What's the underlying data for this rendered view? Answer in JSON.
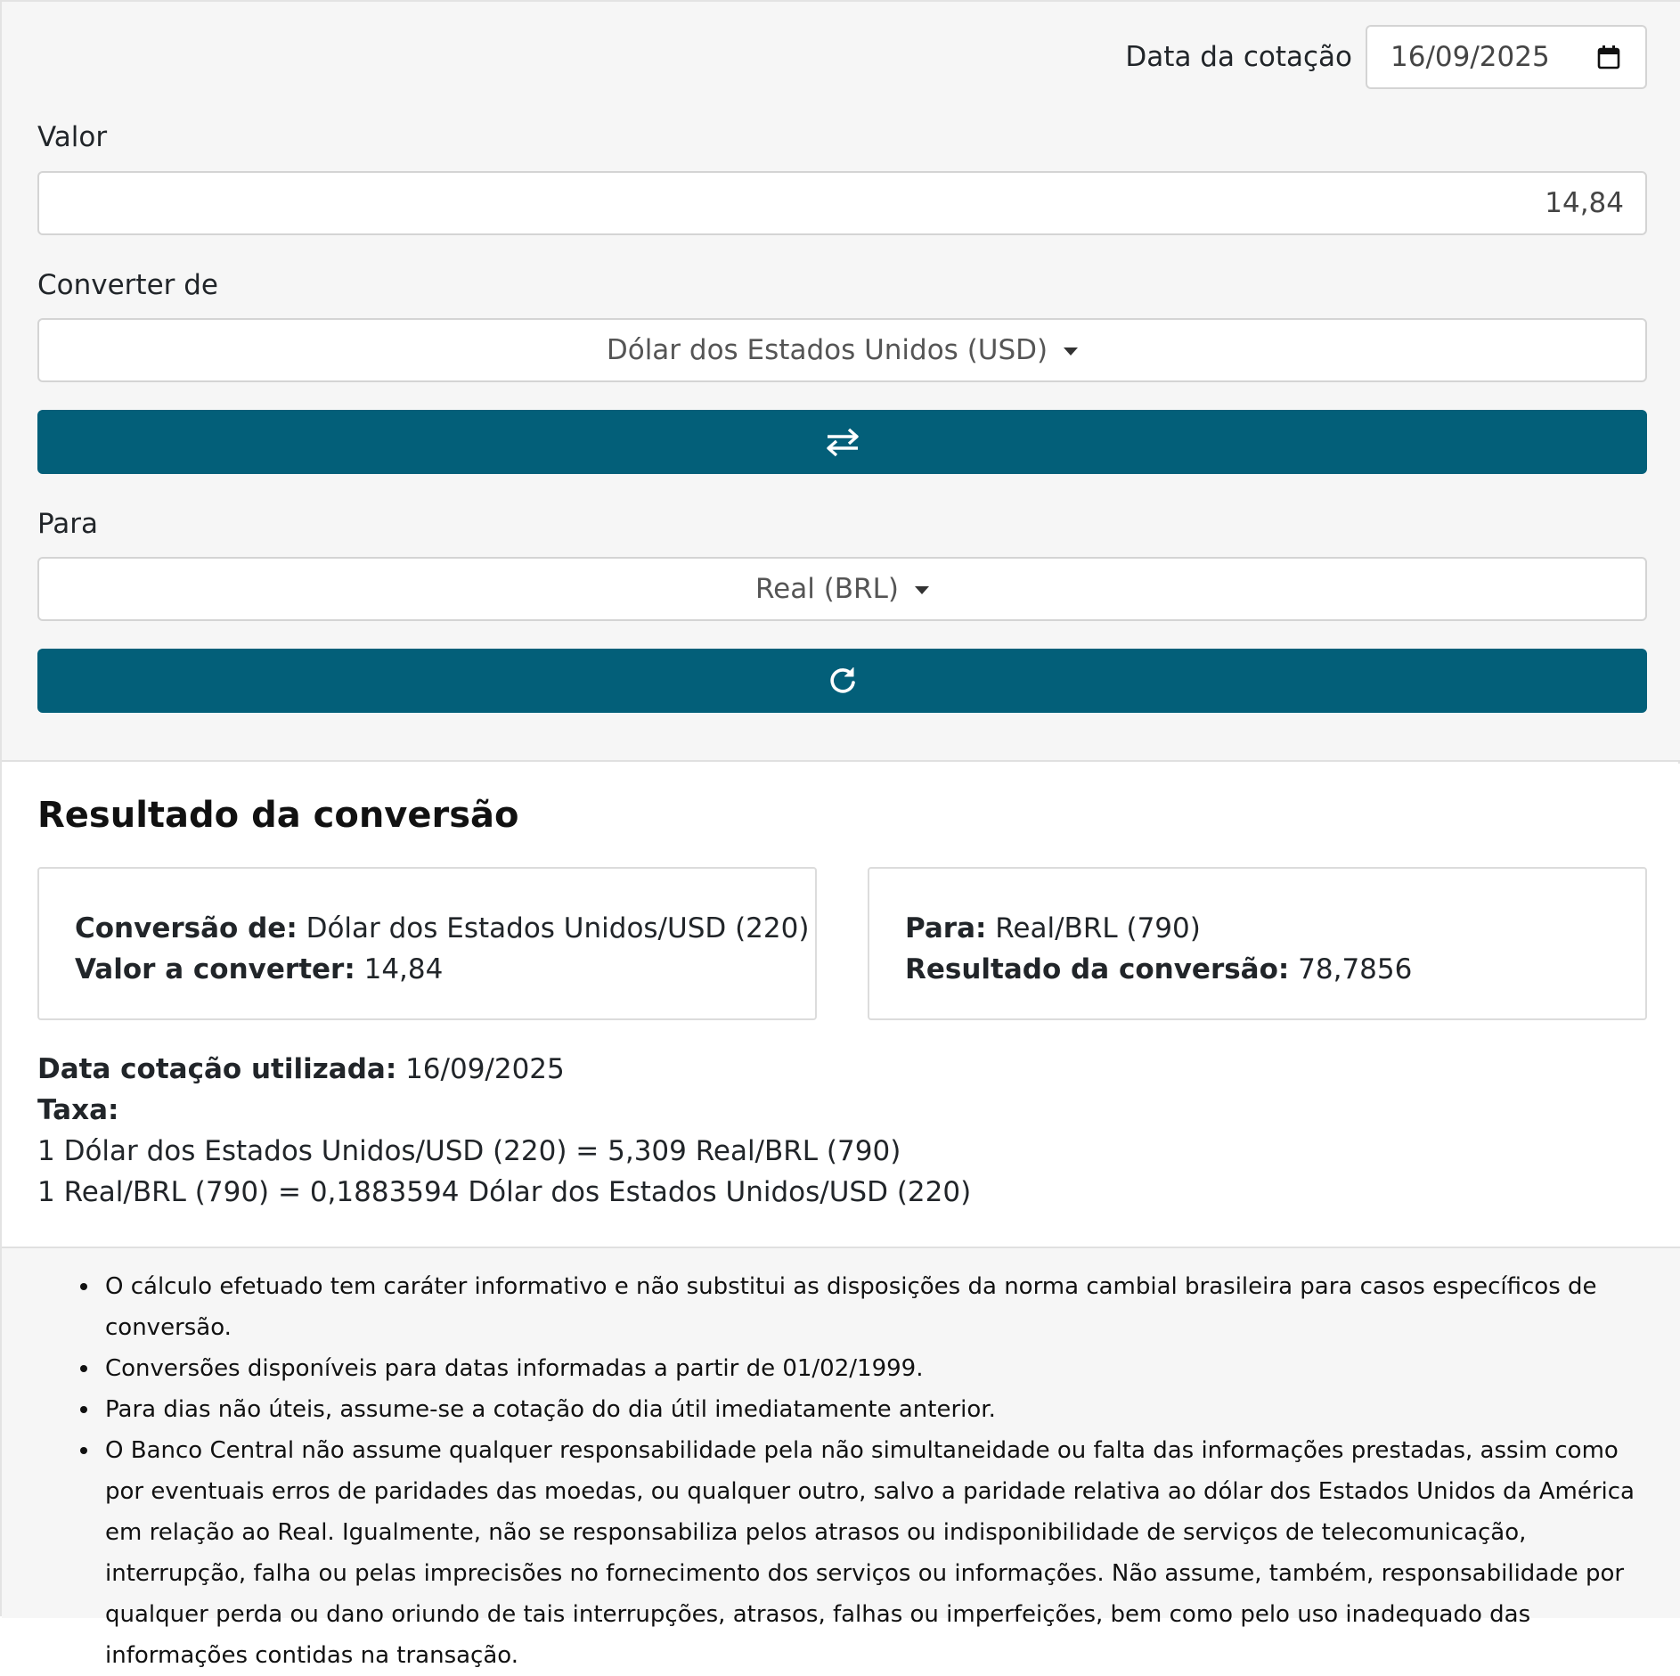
{
  "date": {
    "label": "Data da cotação",
    "value": "16/09/2025",
    "icon": "calendar-icon"
  },
  "valor": {
    "label": "Valor",
    "value": "14,84"
  },
  "from": {
    "label": "Converter de",
    "selected": "Dólar dos Estados Unidos (USD)"
  },
  "swap_button": {
    "icon": "swap-arrows-icon"
  },
  "to": {
    "label": "Para",
    "selected": "Real (BRL)"
  },
  "convert_button": {
    "icon": "refresh-icon"
  },
  "result": {
    "title": "Resultado da conversão",
    "from_label": "Conversão de:",
    "from_value": "Dólar dos Estados Unidos/USD (220)",
    "amount_label": "Valor a converter:",
    "amount_value": "14,84",
    "to_label": "Para:",
    "to_value": "Real/BRL (790)",
    "result_label": "Resultado da conversão:",
    "result_value": "78,7856",
    "date_label": "Data cotação utilizada:",
    "date_value": "16/09/2025",
    "rate_label": "Taxa:",
    "rate_line_1": "1 Dólar dos Estados Unidos/USD (220) = 5,309 Real/BRL (790)",
    "rate_line_2": "1 Real/BRL (790) = 0,1883594 Dólar dos Estados Unidos/USD (220)"
  },
  "notes": [
    "O cálculo efetuado tem caráter informativo e não substitui as disposições da norma cambial brasileira para casos específicos de conversão.",
    "Conversões disponíveis para datas informadas a partir de 01/02/1999.",
    "Para dias não úteis, assume-se a cotação do dia útil imediatamente anterior.",
    "O Banco Central não assume qualquer responsabilidade pela não simultaneidade ou falta das informações prestadas, assim como por eventuais erros de paridades das moedas, ou qualquer outro, salvo a paridade relativa ao dólar dos Estados Unidos da América em relação ao Real. Igualmente, não se responsabiliza pelos atrasos ou indisponibilidade de serviços de telecomunicação, interrupção, falha ou pelas imprecisões no fornecimento dos serviços ou informações. Não assume, também, responsabilidade por qualquer perda ou dano oriundo de tais interrupções, atrasos, falhas ou imperfeições, bem como pelo uso inadequado das informações contidas na transação."
  ],
  "colors": {
    "button_bg": "#035f79",
    "form_bg": "#f6f6f6"
  }
}
